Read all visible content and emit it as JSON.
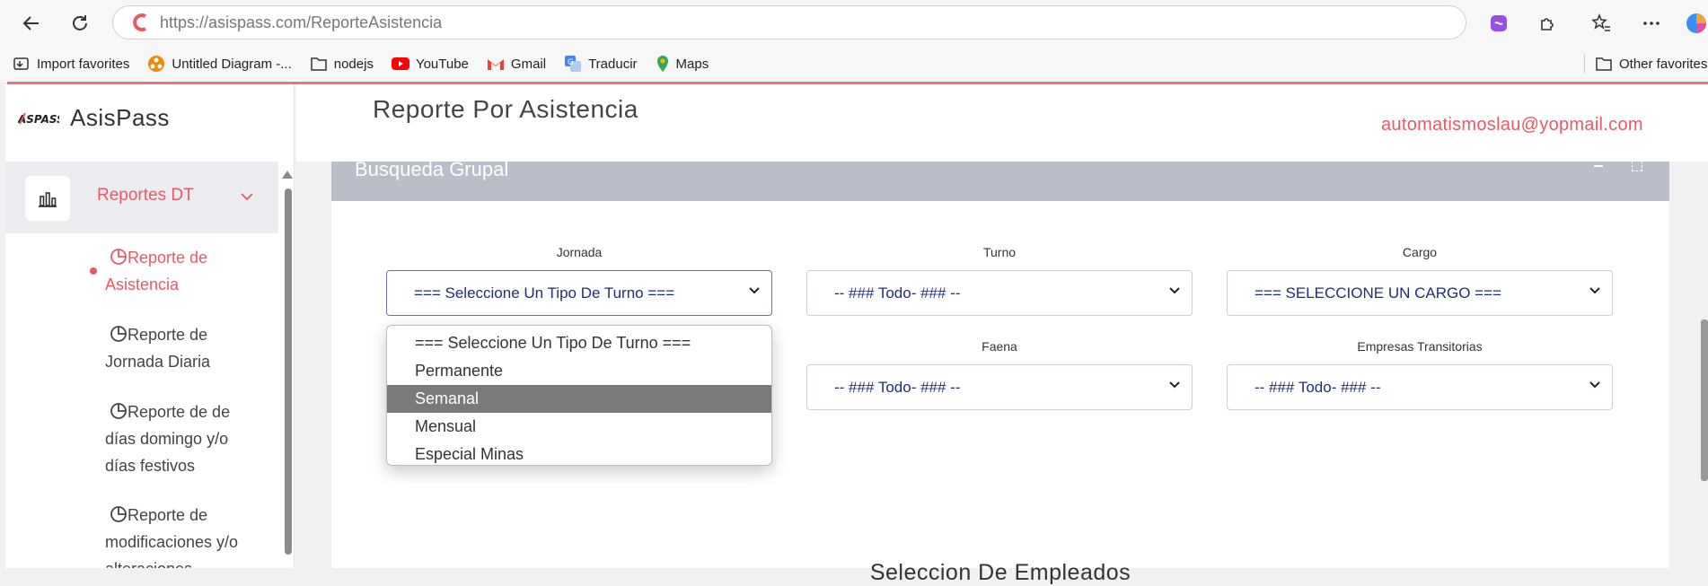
{
  "browser": {
    "url_host": "https://asispass.com/",
    "url_path": "ReporteAsistencia",
    "bookmarks": [
      {
        "label": "Import favorites",
        "icon": "import-icon"
      },
      {
        "label": "Untitled Diagram -...",
        "icon": "drawio-icon"
      },
      {
        "label": "nodejs",
        "icon": "folder-icon"
      },
      {
        "label": "YouTube",
        "icon": "youtube-icon"
      },
      {
        "label": "Gmail",
        "icon": "gmail-icon"
      },
      {
        "label": "Traducir",
        "icon": "translate-icon"
      },
      {
        "label": "Maps",
        "icon": "maps-icon"
      }
    ],
    "other_favorites": "Other favorites"
  },
  "sidebar": {
    "brand_logo": "ASPASS",
    "brand_name": "AsisPass",
    "menu_label": "Reportes DT",
    "items": [
      {
        "label": "Reporte de Asistencia",
        "active": true
      },
      {
        "label": "Reporte de Jornada Diaria"
      },
      {
        "label": "Reporte de de días domingo y/o días festivos"
      },
      {
        "label": "Reporte de modificaciones y/o alteraciones"
      }
    ]
  },
  "header": {
    "title": "Reporte Por Asistencia",
    "user_email": "automatismoslau@yopmail.com"
  },
  "card": {
    "title": "Busqueda Grupal"
  },
  "form": {
    "jornada_label": "Jornada",
    "jornada_value": "=== Seleccione Un Tipo De Turno ===",
    "turno_label": "Turno",
    "turno_value": "-- ### Todo- ### --",
    "cargo_label": "Cargo",
    "cargo_value": "=== SELECCIONE UN CARGO ===",
    "faena_label": "Faena",
    "faena_value": "-- ### Todo- ### --",
    "empresas_label": "Empresas Transitorias",
    "empresas_value": "-- ### Todo- ### --"
  },
  "dropdown": {
    "options": [
      "=== Seleccione Un Tipo De Turno ===",
      "Permanente",
      "Semanal",
      "Mensual",
      "Especial Minas"
    ],
    "highlighted": "Semanal"
  },
  "section": {
    "title": "Seleccion De Empleados"
  },
  "colors": {
    "accent": "#e85867",
    "select_text": "#1f2f75",
    "card_header": "#b9bec8"
  }
}
